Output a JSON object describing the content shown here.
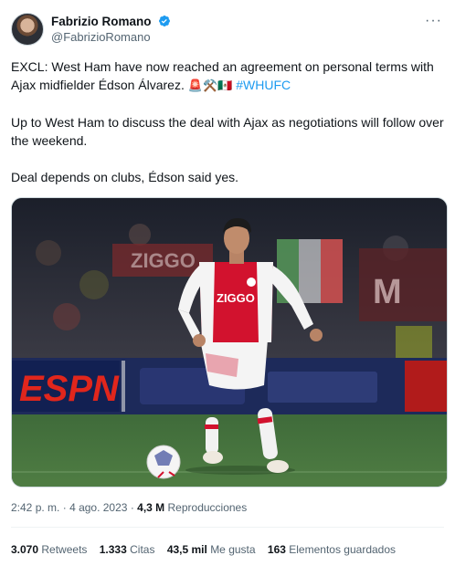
{
  "author": {
    "name": "Fabrizio Romano",
    "handle": "@FabrizioRomano",
    "more_label": "···"
  },
  "tweet": {
    "line1": "EXCL: West Ham have now reached an agreement on personal terms with Ajax midfielder Édson Álvarez.",
    "emojis": "🚨⚒️🇲🇽",
    "hashtag": "#WHUFC",
    "paragraph2": "Up to West Ham to discuss the deal with Ajax as negotiations will follow over the weekend.",
    "paragraph3": "Deal depends on clubs, Édson said yes."
  },
  "media": {
    "banner_text": "ZIGGO",
    "sponsor": "ESPN",
    "board_right": "M"
  },
  "meta": {
    "time": "2:42 p. m.",
    "separator": "·",
    "date": "4 ago. 2023",
    "views_count": "4,3 M",
    "views_label": "Reproducciones"
  },
  "stats": {
    "retweets_count": "3.070",
    "retweets_label": "Retweets",
    "quotes_count": "1.333",
    "quotes_label": "Citas",
    "likes_count": "43,5 mil",
    "likes_label": "Me gusta",
    "bookmarks_count": "163",
    "bookmarks_label": "Elementos guardados"
  },
  "colors": {
    "accent": "#1d9bf0",
    "text": "#0f1419",
    "muted": "#536471",
    "ajax_red": "#d2122e"
  }
}
